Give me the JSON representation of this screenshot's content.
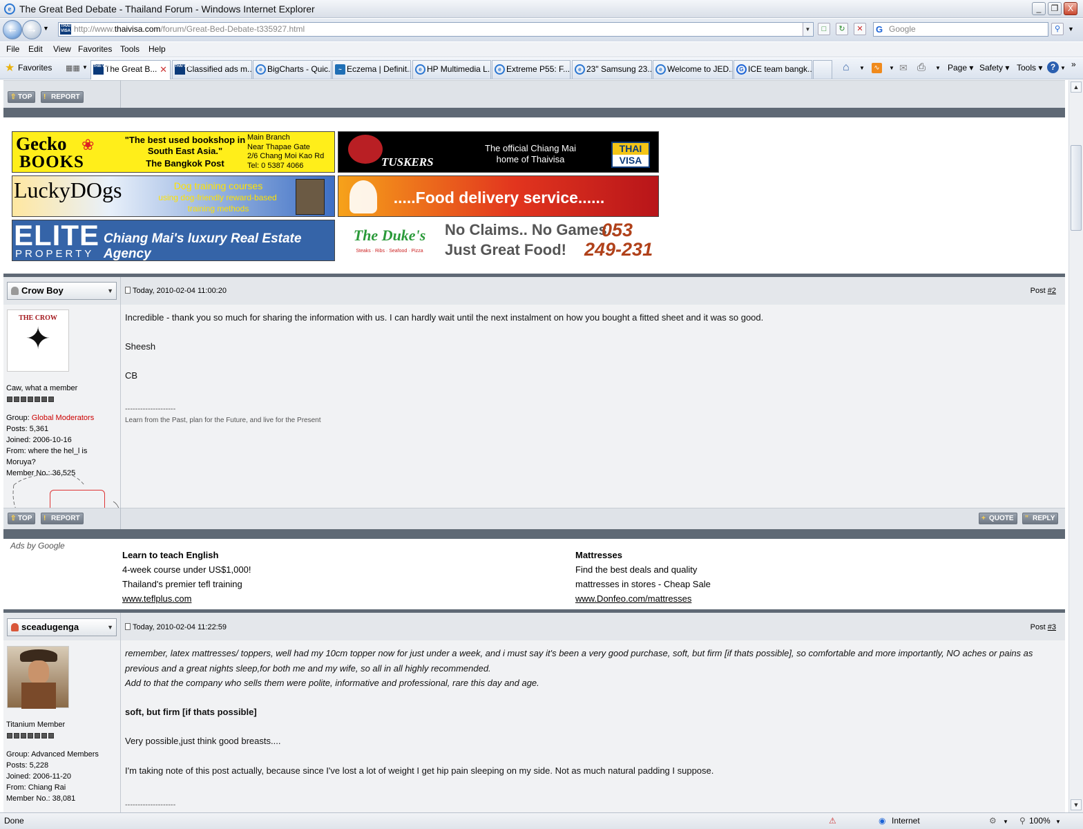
{
  "window": {
    "title": "The Great Bed Debate - Thailand Forum - Windows Internet Explorer",
    "minimize": "_",
    "maximize": "❐",
    "close": "X"
  },
  "address": {
    "url_prefix": "http://www.",
    "url_domain": "thaivisa.com",
    "url_path": "/forum/Great-Bed-Debate-t335927.html",
    "favicon_text": "THAI VISA",
    "search_placeholder": "Google"
  },
  "menu": [
    "File",
    "Edit",
    "View",
    "Favorites",
    "Tools",
    "Help"
  ],
  "favorites_label": "Favorites",
  "tabs": [
    {
      "label": "The Great B...",
      "icon": "thaivisa-icon",
      "active": true
    },
    {
      "label": "Classified ads m...",
      "icon": "thaivisa-icon",
      "active": false
    },
    {
      "label": "BigCharts - Quic...",
      "icon": "ie-icon",
      "active": false
    },
    {
      "label": "Eczema | Definit...",
      "icon": "site-icon",
      "active": false
    },
    {
      "label": "HP Multimedia L...",
      "icon": "ie-icon",
      "active": false
    },
    {
      "label": "Extreme P55: F...",
      "icon": "ie-icon",
      "active": false
    },
    {
      "label": "23\" Samsung 23...",
      "icon": "ie-icon",
      "active": false
    },
    {
      "label": "Welcome to JED...",
      "icon": "ie-icon",
      "active": false
    },
    {
      "label": "ICE team bangk...",
      "icon": "google-icon",
      "active": false
    }
  ],
  "commands": {
    "page": "Page",
    "safety": "Safety",
    "tools": "Tools"
  },
  "buttons": {
    "top": "TOP",
    "report": "REPORT",
    "quote": "QUOTE",
    "reply": "REPLY"
  },
  "ads": {
    "gecko": {
      "brand_top": "Gecko",
      "brand_bottom": "BOOKS",
      "quote": "\"The best used bookshop in South East Asia.\"",
      "source": "The Bangkok Post",
      "address": [
        "Main Branch",
        "Near Thapae Gate",
        "2/6 Chang Moi Kao Rd",
        "Tel: 0 5387 4066"
      ]
    },
    "tuskers": {
      "brand": "TUSKERS",
      "tagline": "The official Chiang Mai home of Thaivisa",
      "badge_top": "THAI",
      "badge_bottom": "VISA"
    },
    "luckydogs": {
      "brand": "LuckyDOgs",
      "line1": "Dog training courses",
      "line2": "using dog-friendly reward-based",
      "line3": "training methods"
    },
    "food": {
      "text": ".....Food delivery service......"
    },
    "elite": {
      "brand": "ELITE",
      "sub": "PROPERTY",
      "tagline": "Chiang Mai's luxury Real Estate Agency"
    },
    "dukes": {
      "brand": "The Duke's",
      "sub": "Steaks · Ribs · Seafood · Pizza",
      "line1": "No Claims.. No Games..",
      "line2": "Just Great Food!",
      "phone1": "053",
      "phone2": "249-231"
    }
  },
  "posts": [
    {
      "username": "Crow Boy",
      "avatar_caption": "THE CROW",
      "rank": "Caw, what a member",
      "group_label": "Group:",
      "group": "Global Moderators",
      "posts": "Posts: 5,361",
      "joined": "Joined: 2006-10-16",
      "from": "From: where the hel_l is Moruya?",
      "member_no": "Member No.: 36,525",
      "date": "Today, 2010-02-04 11:00:20",
      "post_label": "Post",
      "post_num": "#2",
      "body": [
        "Incredible - thank you so much for sharing the information with us. I can hardly wait until the next instalment on how you bought a fitted sheet and it was so good.",
        "Sheesh",
        "CB"
      ],
      "sig_sep": "--------------------",
      "signature": "Learn from the Past, plan for the Future, and live for the Present"
    },
    {
      "username": "sceadugenga",
      "rank": "Titanium Member",
      "group_label": "Group:",
      "group": "Advanced Members",
      "posts": "Posts: 5,228",
      "joined": "Joined: 2006-11-20",
      "from": "From: Chiang Rai",
      "member_no": "Member No.: 38,081",
      "date": "Today, 2010-02-04 11:22:59",
      "post_label": "Post",
      "post_num": "#3",
      "quote_lines": [
        "remember, latex mattresses/ toppers, well had my 10cm topper now for just under a week, and i must say it's been a very good purchase, soft, but firm [if thats possible], so comfortable and more importantly, NO aches or pains as",
        "previous and a great nights sleep,for both me and my wife, so all in all highly recommended.",
        "Add to that the company who sells them were polite, informative and professional, rare this day and age."
      ],
      "bold_quote": "soft, but firm [if thats possible]",
      "reply1": "Very possible,just think good breasts....",
      "reply2": "I'm taking note of this post actually, because since I've lost a lot of weight I get hip pain sleeping on my side. Not as much natural padding I suppose.",
      "sig_sep": "--------------------"
    }
  ],
  "google_ads": {
    "label": "Ads by Google",
    "ad1": {
      "title": "Learn to teach English",
      "line1": "4-week course under US$1,000!",
      "line2": "Thailand's premier tefl training",
      "url": "www.teflplus.com"
    },
    "ad2": {
      "title": "Mattresses",
      "line1": "Find the best deals and quality",
      "line2": "mattresses in stores - Cheap Sale",
      "url": "www.Donfeo.com/mattresses"
    }
  },
  "status": {
    "text": "Done",
    "zone": "Internet",
    "zoom": "100%"
  },
  "colors": {
    "group_moderator": "#cc0000",
    "bar": "#5f6975",
    "tab_active": "#ffffff"
  }
}
